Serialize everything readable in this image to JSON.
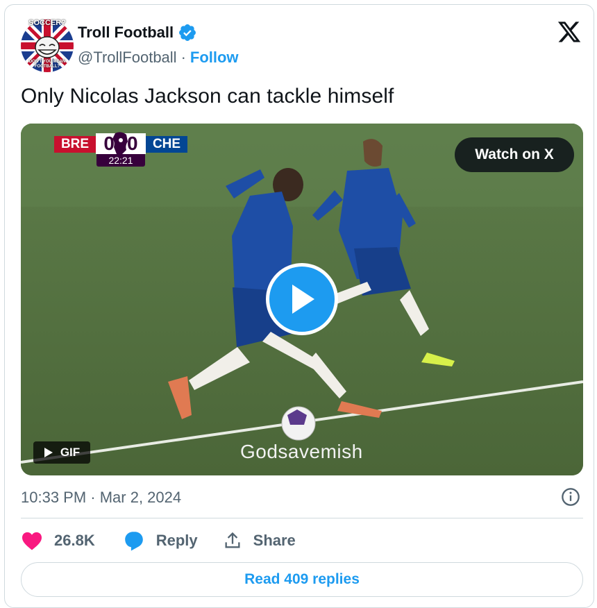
{
  "author": {
    "name": "Troll Football",
    "handle": "@TrollFootball",
    "separator": "·",
    "follow_label": "Follow",
    "avatar_top_text": "SOCCER?",
    "avatar_bottom_text": "DON'T YOU MEAN FOOTBALL?",
    "verified": true
  },
  "tweet": {
    "text": "Only Nicolas Jackson can tackle himself"
  },
  "media": {
    "scoreboard": {
      "home": "BRE",
      "home_score": "0",
      "away_score": "0",
      "away": "CHE",
      "clock": "22:21"
    },
    "watch_label": "Watch on X",
    "gif_label": "GIF",
    "watermark": "Godsavemish"
  },
  "meta": {
    "timestamp": "10:33 PM · Mar 2, 2024"
  },
  "actions": {
    "likes": "26.8K",
    "reply_label": "Reply",
    "share_label": "Share"
  },
  "read_replies_label": "Read 409 replies",
  "colors": {
    "accent": "#1d9bf0",
    "like": "#f91880",
    "text": "#0f1419",
    "secondary": "#536471",
    "border": "#cfd9de"
  },
  "icons": [
    "verified-badge-icon",
    "x-logo-icon",
    "play-icon",
    "gif-play-icon",
    "info-icon",
    "heart-icon",
    "reply-icon",
    "share-icon"
  ]
}
